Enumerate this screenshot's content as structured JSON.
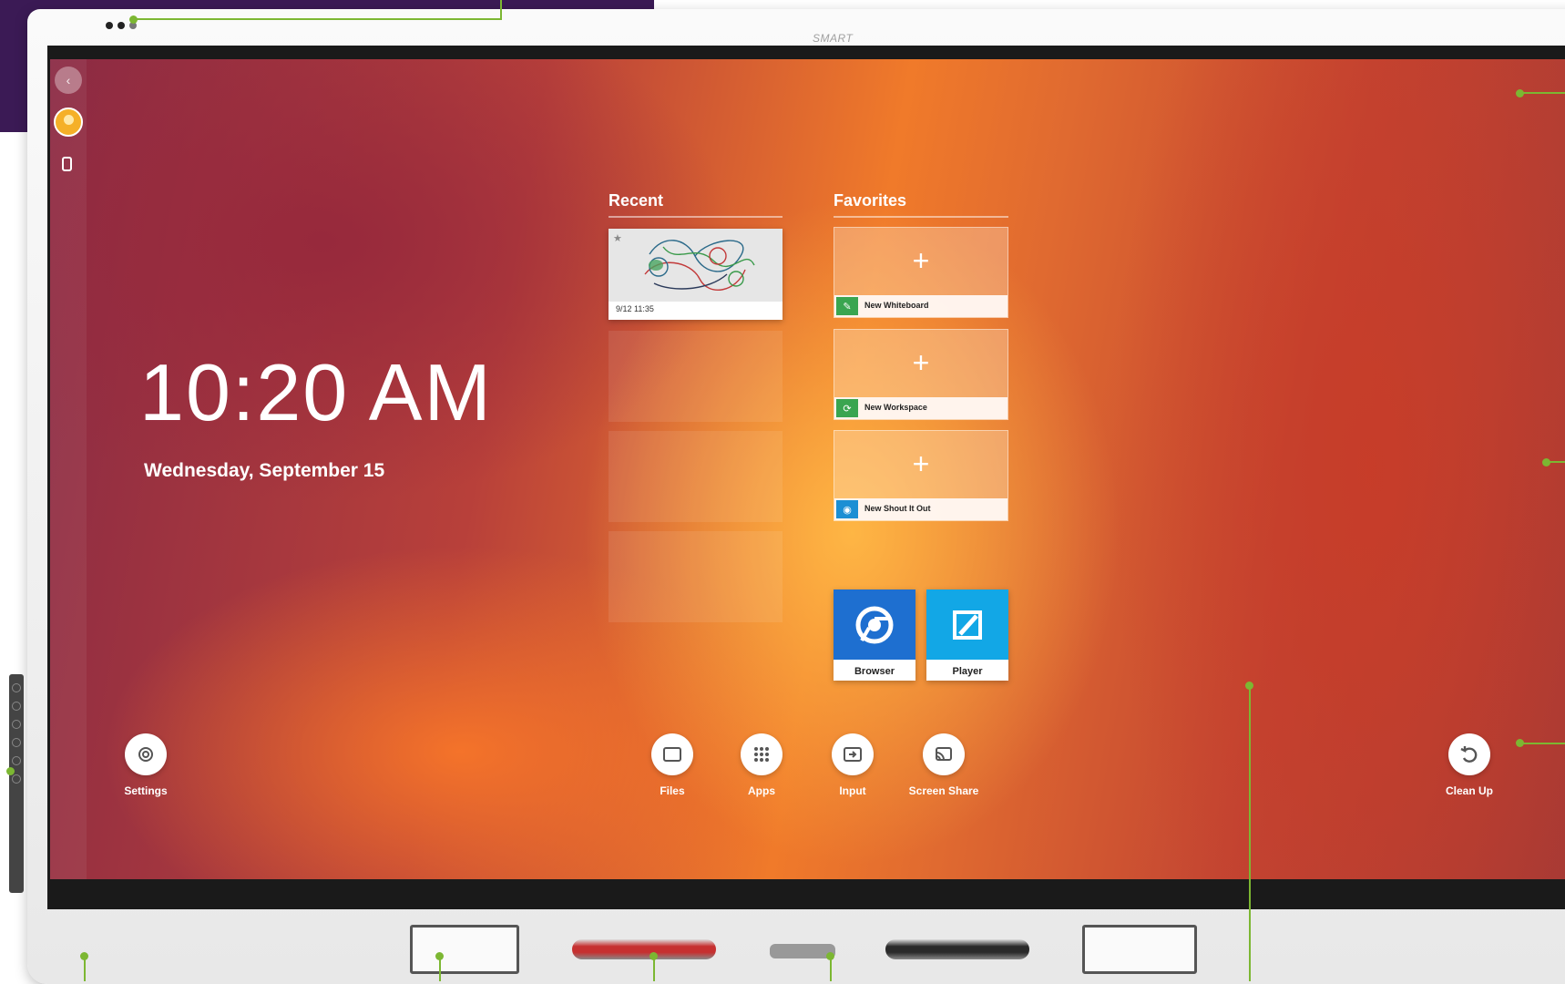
{
  "device": {
    "brand": "SMART"
  },
  "clock": {
    "time": "10:20 AM",
    "date": "Wednesday, September 15"
  },
  "recent": {
    "title": "Recent",
    "items": [
      {
        "timestamp": "9/12 11:35"
      }
    ]
  },
  "favorites": {
    "title": "Favorites",
    "tiles": [
      {
        "label": "New Whiteboard",
        "icon": "whiteboard-icon"
      },
      {
        "label": "New Workspace",
        "icon": "workspace-icon"
      },
      {
        "label": "New Shout It Out",
        "icon": "shout-it-out-icon"
      }
    ],
    "apps": [
      {
        "label": "Browser",
        "icon": "chrome-icon"
      },
      {
        "label": "Player",
        "icon": "player-icon"
      }
    ]
  },
  "dock": {
    "settings": "Settings",
    "files": "Files",
    "apps": "Apps",
    "input": "Input",
    "screen_share": "Screen Share",
    "clean_up": "Clean Up"
  },
  "colors": {
    "callout": "#7cb732",
    "purple_block": "#3b1a55",
    "chrome_blue": "#1e6fd0",
    "player_cyan": "#12a7e6",
    "whiteboard_green": "#3aa550"
  }
}
